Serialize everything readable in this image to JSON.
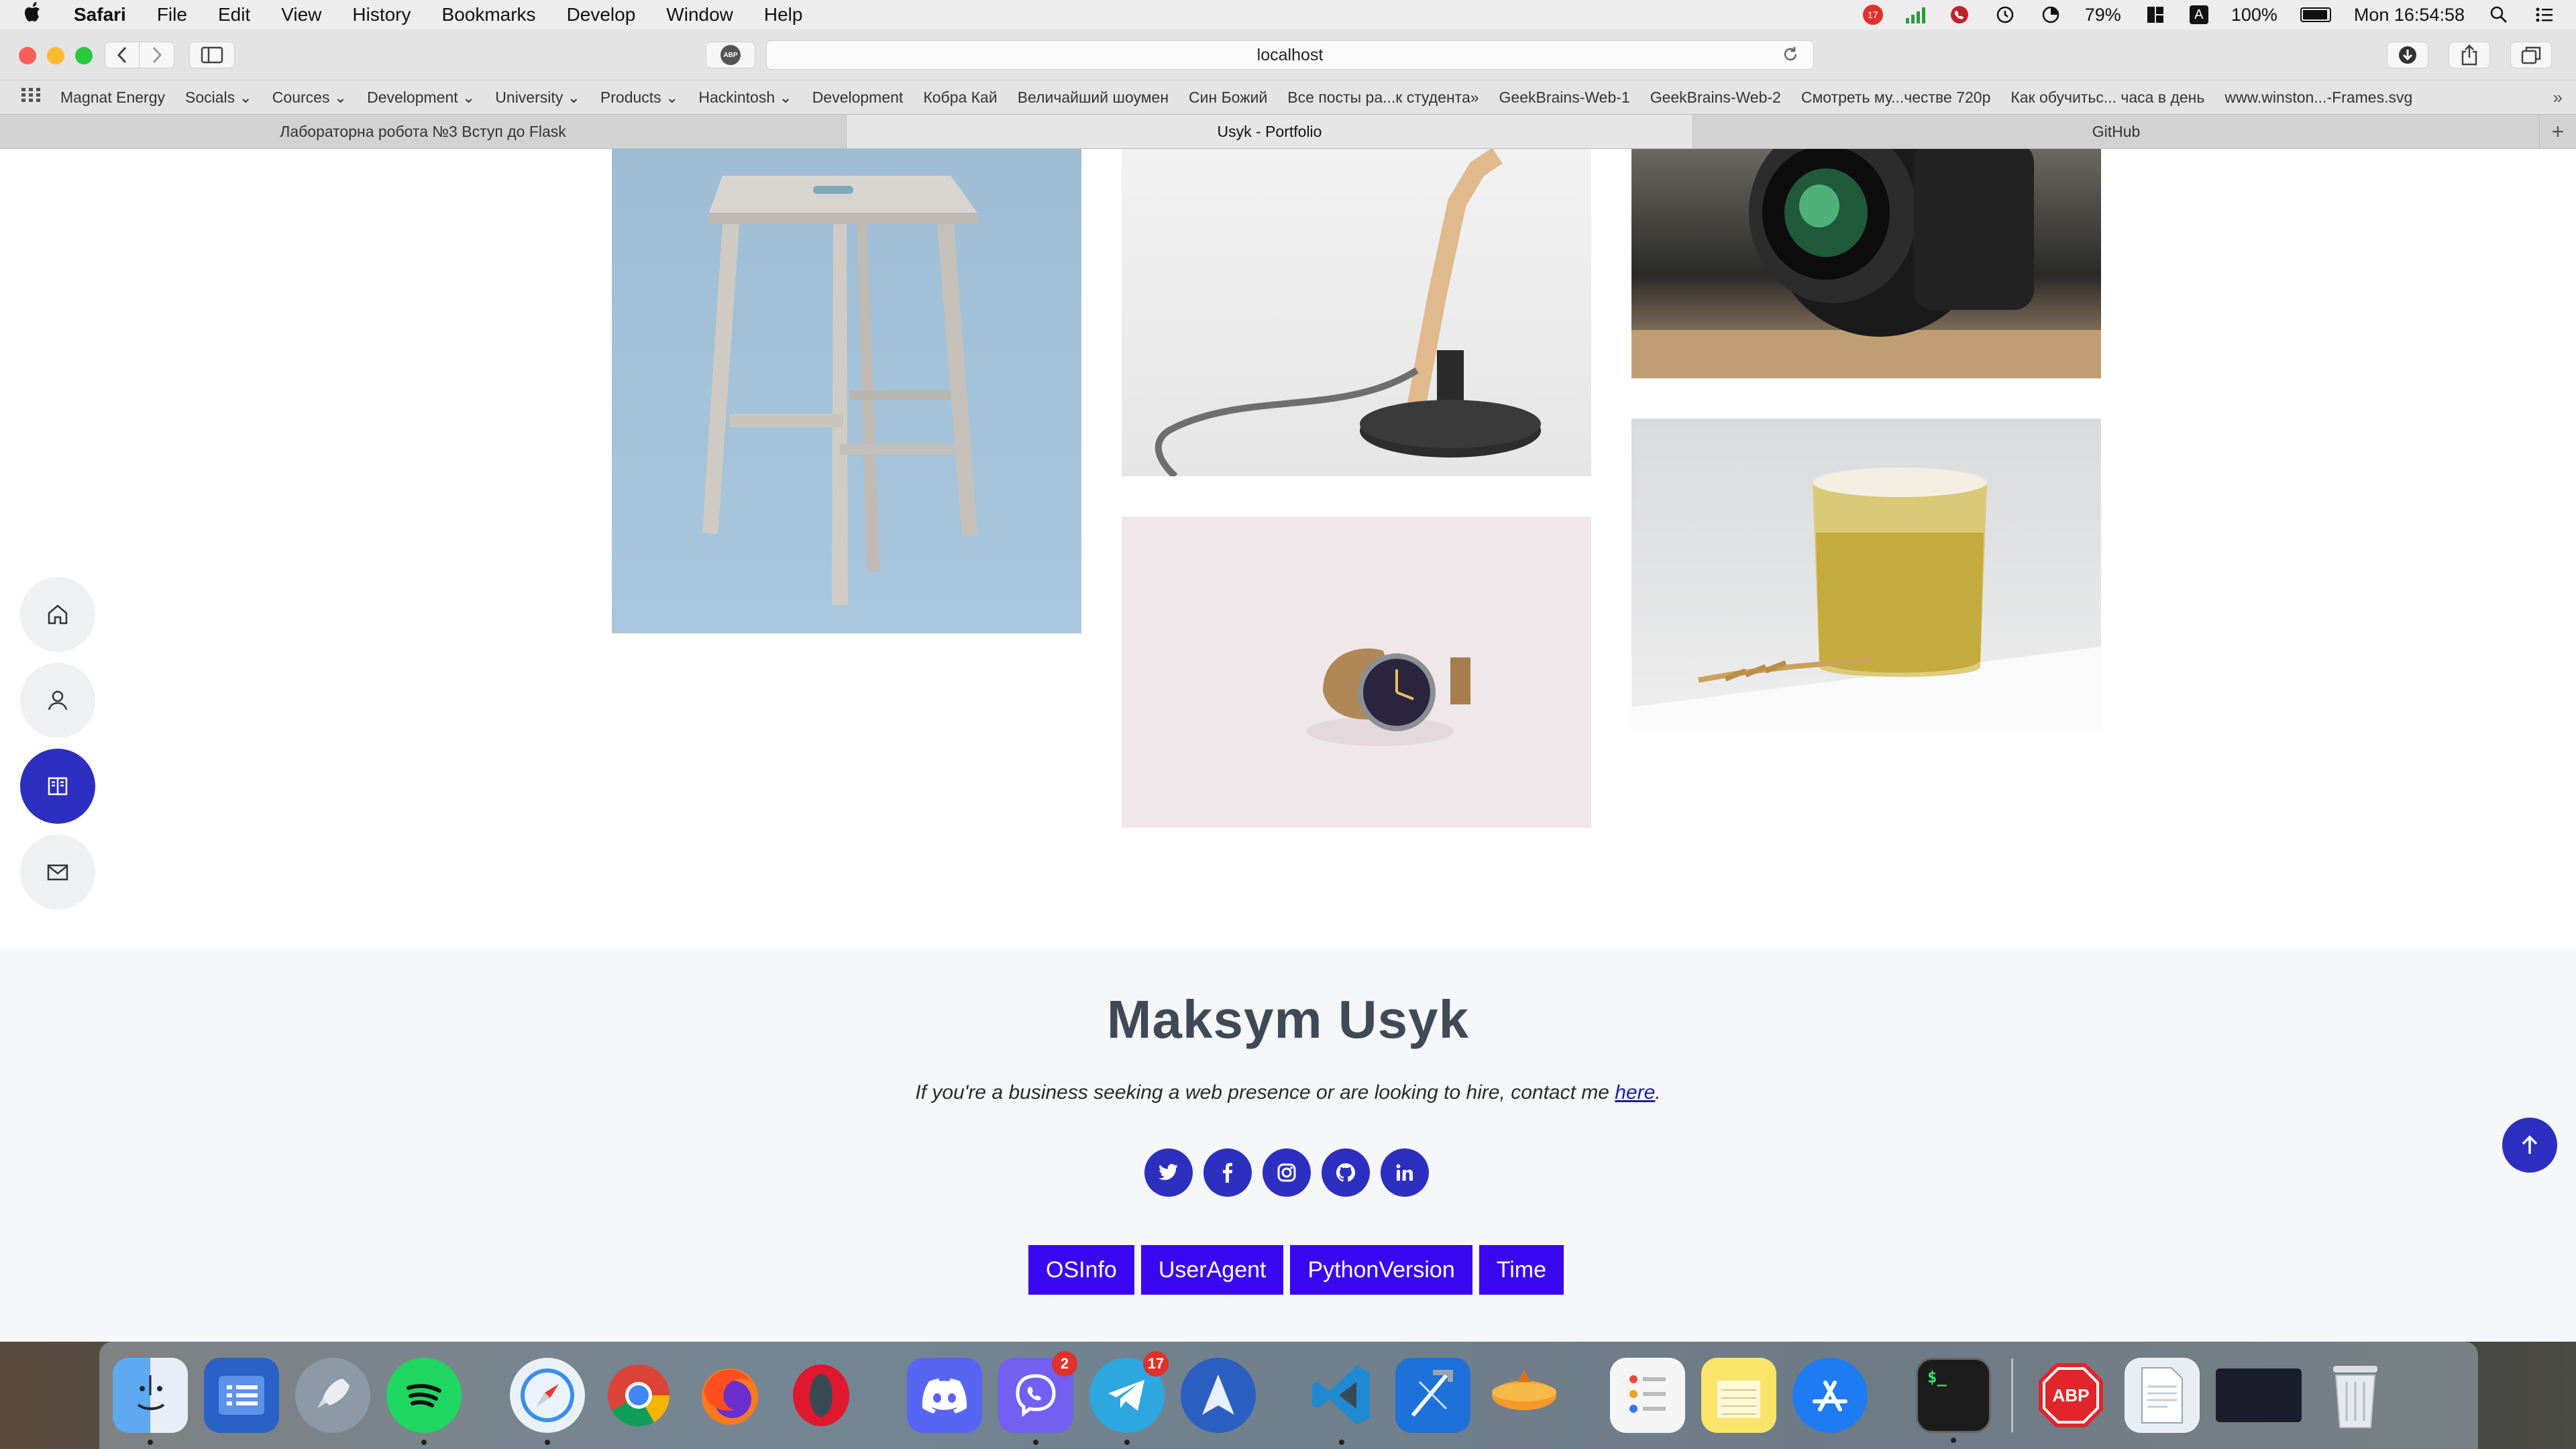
{
  "menubar": {
    "app": "Safari",
    "items": [
      "File",
      "Edit",
      "View",
      "History",
      "Bookmarks",
      "Develop",
      "Window",
      "Help"
    ],
    "wifi_percent": "79%",
    "battery": "100%",
    "clock": "Mon 16:54:58",
    "badge_count": "17",
    "input_source": "A"
  },
  "toolbar": {
    "url": "localhost",
    "abp_label": "ABP"
  },
  "bookmarks": [
    "Magnat Energy",
    "Socials ⌄",
    "Cources ⌄",
    "Development ⌄",
    "University ⌄",
    "Products ⌄",
    "Hackintosh ⌄",
    "Development",
    "Кобра Кай",
    "Величайший шоумен",
    "Син Божий",
    "Все посты ра...к студента»",
    "GeekBrains-Web-1",
    "GeekBrains-Web-2",
    "Смотреть му...честве 720р",
    "Как обучитьс... часа в день",
    "www.winston...-Frames.svg"
  ],
  "tabs": [
    {
      "title": "Лабораторна робота №3 Вступ до Flask",
      "active": false
    },
    {
      "title": "Usyk - Portfolio",
      "active": true
    },
    {
      "title": "GitHub",
      "active": false
    }
  ],
  "portfolio_images": [
    "stool",
    "desk-lamp",
    "camera-lens",
    "wristwatch",
    "glass-with-wheat"
  ],
  "side_nav": [
    "home-icon",
    "user-icon",
    "portfolio-icon",
    "mail-icon"
  ],
  "footer": {
    "name": "Maksym Usyk",
    "tagline_before": "If you're a business seeking a web presence or are looking to hire, contact me ",
    "tagline_link": "here",
    "tagline_after": ".",
    "socials": [
      "twitter-icon",
      "facebook-icon",
      "instagram-icon",
      "github-icon",
      "linkedin-icon"
    ],
    "buttons": [
      "OSInfo",
      "UserAgent",
      "PythonVersion",
      "Time"
    ]
  },
  "dock": {
    "viber_badge": "2",
    "telegram_badge": "17",
    "abp_label": "ABP",
    "terminal_label": "$_"
  },
  "colors": {
    "accent": "#2c2fbf",
    "button": "#3a08f0",
    "link": "#1d1aa5"
  }
}
